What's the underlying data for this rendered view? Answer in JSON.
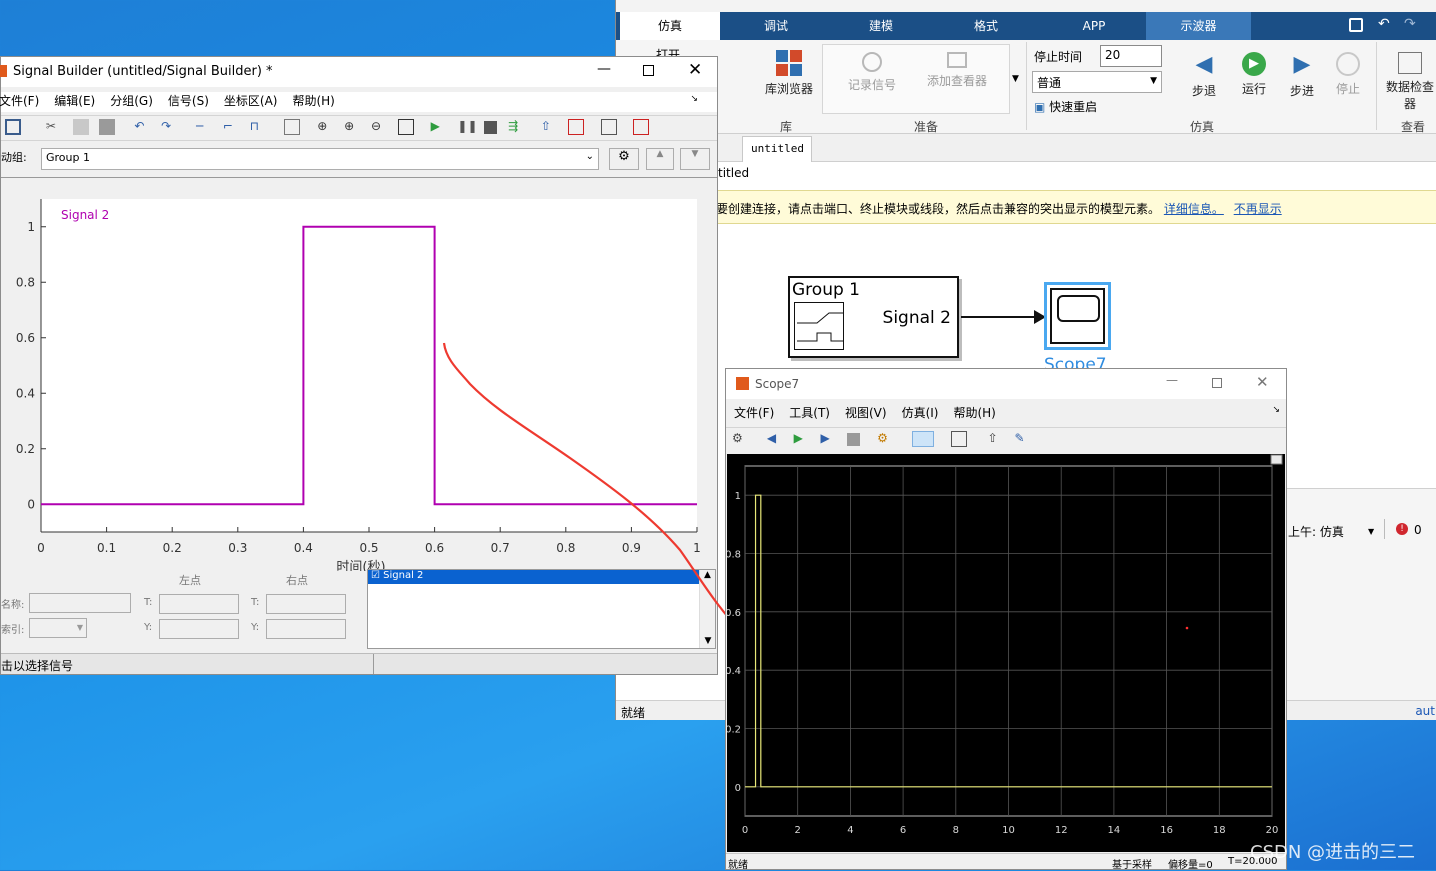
{
  "simulink": {
    "tabs": [
      "仿真",
      "调试",
      "建模",
      "格式",
      "APP",
      "示波器"
    ],
    "open_label": "打开",
    "ribbon": {
      "lib_browser": "库浏览器",
      "record_signal": "记录信号",
      "add_viewer": "添加查看器",
      "stop_time_label": "停止时间",
      "stop_time_value": "20",
      "mode_value": "普通",
      "fast_restart": "快速重启",
      "step_back": "步退",
      "run": "运行",
      "step_forward": "步进",
      "stop": "停止",
      "data_inspect": "数据检查器",
      "groups": [
        "库",
        "准备",
        "仿真",
        "查看"
      ]
    },
    "doc_tab": "untitled",
    "breadcrumb": "titled",
    "info_bar": {
      "text": "要创建连接，请点击端口、终止模块或线段，然后点击兼容的突出显示的模型元素。",
      "link1": "详细信息。",
      "link2": "不再显示"
    },
    "block_group": {
      "title": "Group 1",
      "port": "Signal 2"
    },
    "block_scope": {
      "label": "Scope7"
    },
    "status_ready": "就绪",
    "status_right": "上午: 仿真",
    "error_count": "0",
    "auto": "aut"
  },
  "signal_builder": {
    "title": "Signal Builder (untitled/Signal Builder) *",
    "menu": [
      "文件(F)",
      "编辑(E)",
      "分组(G)",
      "信号(S)",
      "坐标区(A)",
      "帮助(H)"
    ],
    "active_group_label": "动组:",
    "active_group_value": "Group 1",
    "plot": {
      "signal_label": "Signal 2",
      "xlabel": "时间(秒)"
    },
    "left_point": "左点",
    "right_point": "右点",
    "name_label": "名称:",
    "index_label": "索引:",
    "t_label": "T:",
    "y_label": "Y:",
    "signal_list": [
      "Signal 2"
    ],
    "status": "击以选择信号"
  },
  "scope": {
    "title": "Scope7",
    "menu": [
      "文件(F)",
      "工具(T)",
      "视图(V)",
      "仿真(I)",
      "帮助(H)"
    ],
    "status_left": "就绪",
    "status_sample": "基于采样",
    "status_offset": "偏移量=0",
    "status_time": "T=20.000"
  },
  "watermark": "CSDN @进击的三二",
  "chart_data": [
    {
      "type": "line",
      "series": [
        {
          "name": "Signal 2",
          "x": [
            0,
            0.4,
            0.4,
            0.6,
            0.6,
            1
          ],
          "y": [
            0,
            0,
            1,
            1,
            0,
            0
          ]
        }
      ],
      "xlabel": "时间(秒)",
      "ylabel": "",
      "xlim": [
        0,
        1
      ],
      "ylim": [
        -0.1,
        1.1
      ],
      "xticks": [
        0,
        0.1,
        0.2,
        0.3,
        0.4,
        0.5,
        0.6,
        0.7,
        0.8,
        0.9,
        1
      ],
      "yticks": [
        0,
        0.2,
        0.4,
        0.6,
        0.8,
        1
      ],
      "color": "#b000b0",
      "grid": false
    },
    {
      "type": "line",
      "series": [
        {
          "x": [
            0,
            0.4,
            0.4,
            0.6,
            0.6,
            20
          ],
          "y": [
            0,
            0,
            1,
            1,
            0,
            0
          ]
        }
      ],
      "xlim": [
        0,
        20
      ],
      "ylim": [
        -0.1,
        1.1
      ],
      "xticks": [
        0,
        2,
        4,
        6,
        8,
        10,
        12,
        14,
        16,
        18,
        20
      ],
      "yticks": [
        0,
        0.2,
        0.4,
        0.6,
        0.8,
        1
      ],
      "background": "#000000",
      "color": "#e8e878",
      "grid": true
    }
  ]
}
